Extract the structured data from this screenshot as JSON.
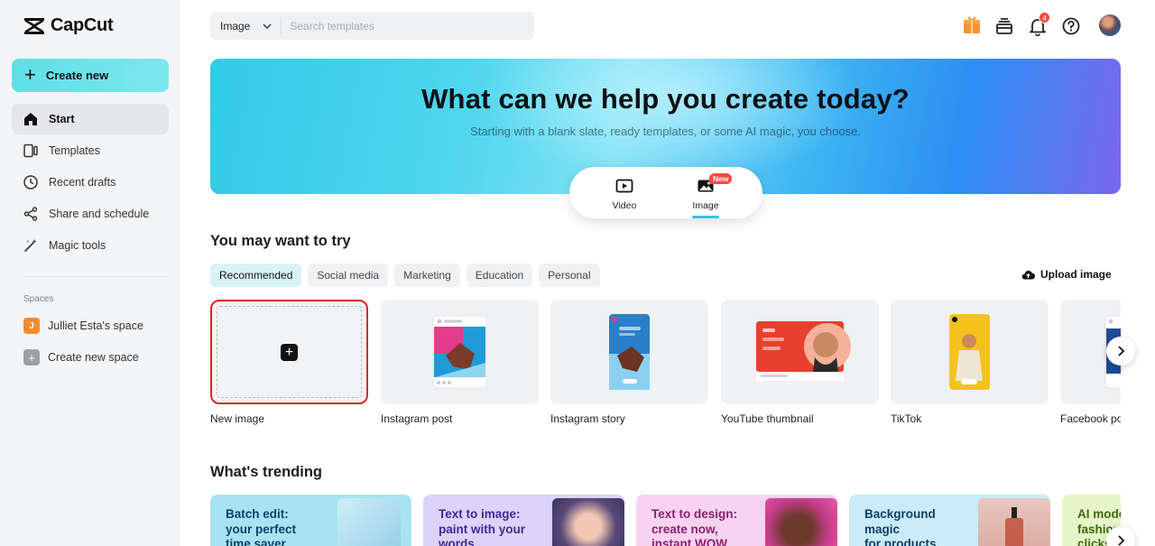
{
  "app": {
    "name": "CapCut"
  },
  "sidebar": {
    "create_label": "Create new",
    "items": [
      {
        "label": "Start"
      },
      {
        "label": "Templates"
      },
      {
        "label": "Recent drafts"
      },
      {
        "label": "Share and schedule"
      },
      {
        "label": "Magic tools"
      }
    ],
    "spaces_title": "Spaces",
    "spaces": [
      {
        "initial": "J",
        "label": "Julliet Esta's space"
      },
      {
        "initial": "+",
        "label": "Create new space"
      }
    ]
  },
  "topbar": {
    "search_type": "Image",
    "search_placeholder": "Search templates",
    "notification_count": "4"
  },
  "hero": {
    "title": "What can we help you create today?",
    "subtitle": "Starting with a blank slate, ready templates, or some AI magic, you choose.",
    "modes": [
      {
        "label": "Video"
      },
      {
        "label": "Image"
      }
    ],
    "new_badge": "New"
  },
  "try_section": {
    "title": "You may want to try",
    "filters": [
      "Recommended",
      "Social media",
      "Marketing",
      "Education",
      "Personal"
    ],
    "upload_label": "Upload image",
    "cards": [
      {
        "label": "New image"
      },
      {
        "label": "Instagram post"
      },
      {
        "label": "Instagram story"
      },
      {
        "label": "YouTube thumbnail"
      },
      {
        "label": "TikTok"
      },
      {
        "label": "Facebook post"
      }
    ]
  },
  "trending": {
    "title": "What's trending",
    "cards": [
      {
        "line1": "Batch edit:",
        "line2": "your perfect",
        "line3": "time saver"
      },
      {
        "line1": "Text to image:",
        "line2": "paint with your",
        "line3": "words"
      },
      {
        "line1": "Text to design:",
        "line2": "create now,",
        "line3": "instant WOW"
      },
      {
        "line1": "Background",
        "line2": "magic",
        "line3": "for products"
      },
      {
        "line1": "AI model",
        "line2": "fashion",
        "line3": "clicks"
      }
    ]
  },
  "colors": {
    "accent": "#33c6dc",
    "create_button": "#5fdfe6",
    "alert": "#f54a45",
    "selection_outline": "#e0261f"
  }
}
